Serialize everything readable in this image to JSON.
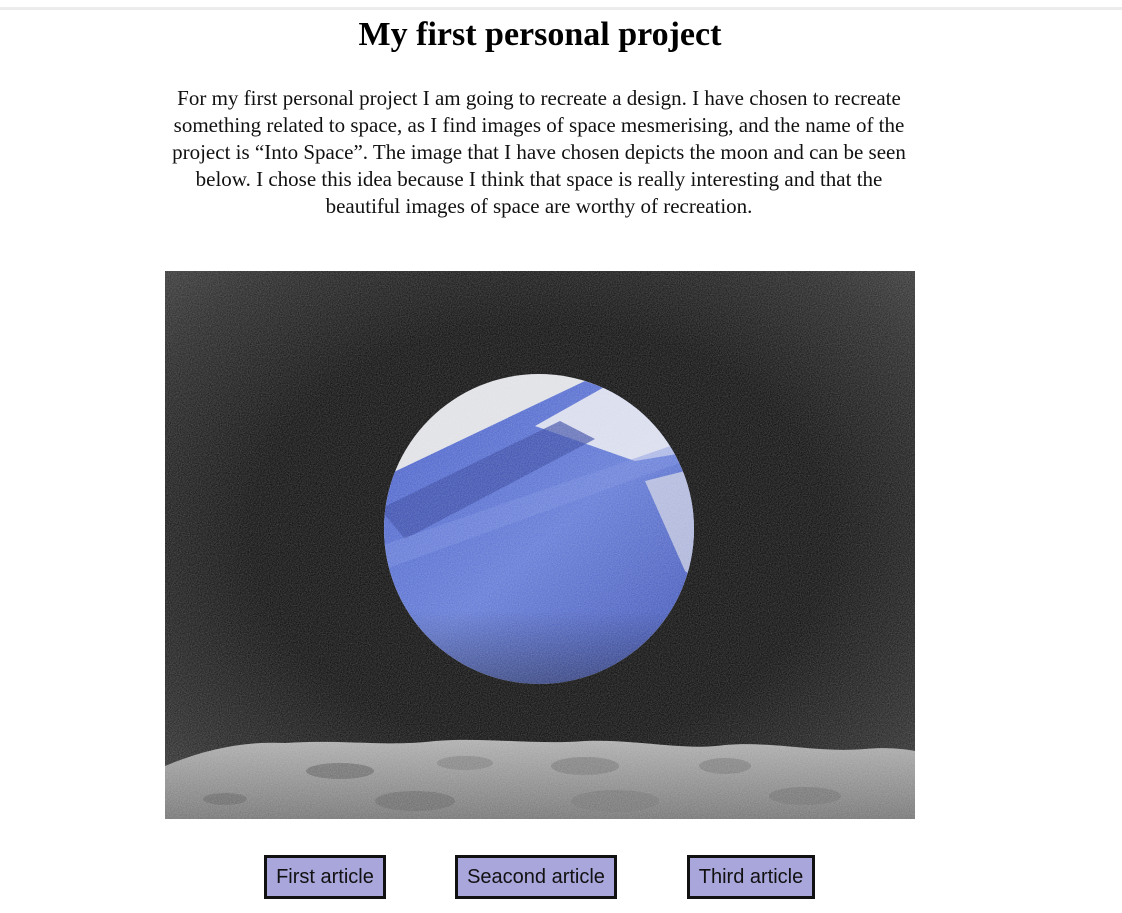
{
  "page": {
    "title": "My first personal project",
    "intro": "For my first personal project I am going to recreate a design. I have chosen to recreate something related to space, as I find images of space mesmerising, and the name of the project is “Into Space”. The image that I have chosen depicts the moon and can be seen below. I chose this idea because I think that space is really interesting and that the beautiful images of space are worthy of recreation."
  },
  "hero_image": {
    "subject": "moon-surface-and-planet-illustration",
    "colors": {
      "sky": "#050505",
      "planet_blue": "#4b63c9",
      "planet_light": "#e2e2e6",
      "ground": "#9b9b9b"
    }
  },
  "articles": [
    {
      "label": "First article"
    },
    {
      "label": "Seacond article"
    },
    {
      "label": "Third article"
    }
  ],
  "theme": {
    "button_bg": "#a9a6dc",
    "button_border": "#111111"
  }
}
